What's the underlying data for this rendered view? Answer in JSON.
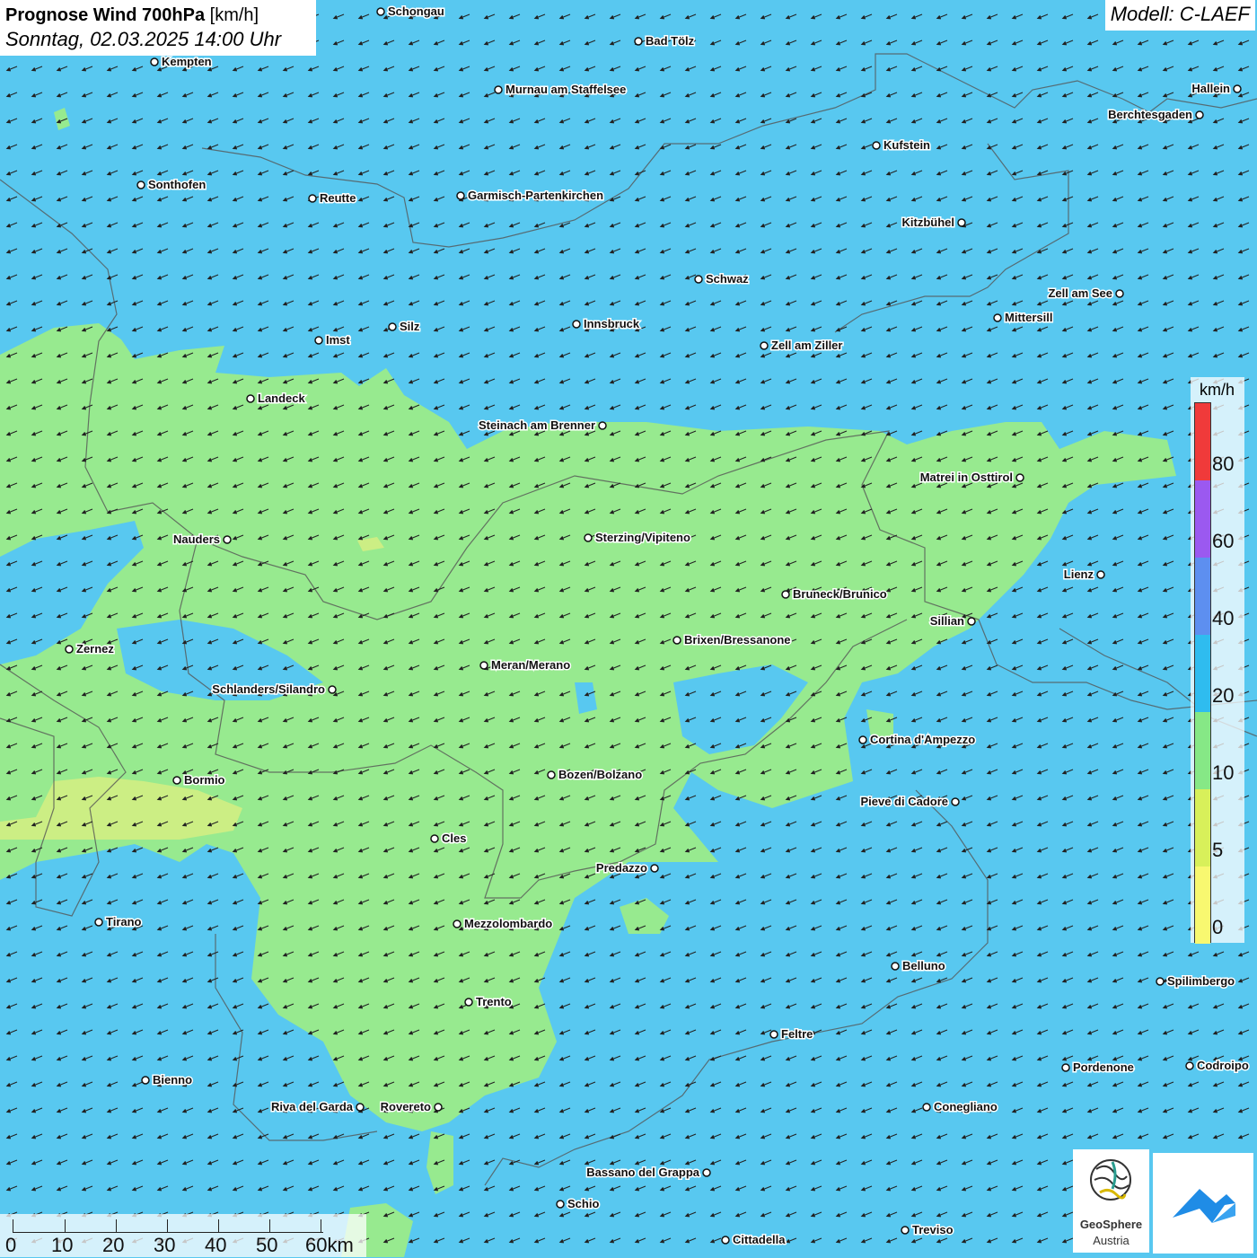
{
  "header": {
    "title_bold": "Prognose Wind 700hPa",
    "title_unit": "[km/h]",
    "datetime": "Sonntag, 02.03.2025 14:00 Uhr",
    "model": "Modell: C-LAEF"
  },
  "legend": {
    "unit": "km/h",
    "labels": [
      "80",
      "60",
      "40",
      "20",
      "10",
      "5",
      "0"
    ],
    "colors": [
      "#f03a3a",
      "#9b59f0",
      "#5d8ff0",
      "#2fbcef",
      "#86e886",
      "#d8f05a",
      "#f8f870"
    ]
  },
  "scalebar": {
    "labels": [
      "0",
      "10",
      "20",
      "30",
      "40",
      "50",
      "60km"
    ]
  },
  "logos": {
    "brand_line1": "GeoSphere",
    "brand_line2": "Austria"
  },
  "cities": [
    {
      "name": "Schongau"
    },
    {
      "name": "Bad Tölz"
    },
    {
      "name": "Kempten"
    },
    {
      "name": "Murnau am Staffelsee"
    },
    {
      "name": "Hallein"
    },
    {
      "name": "Berchtesgaden"
    },
    {
      "name": "Kufstein"
    },
    {
      "name": "Sonthofen"
    },
    {
      "name": "Reutte"
    },
    {
      "name": "Garmisch-Partenkirchen"
    },
    {
      "name": "Kitzbühel"
    },
    {
      "name": "Schwaz"
    },
    {
      "name": "Zell am See"
    },
    {
      "name": "Mittersill"
    },
    {
      "name": "Imst"
    },
    {
      "name": "Silz"
    },
    {
      "name": "Innsbruck"
    },
    {
      "name": "Zell am Ziller"
    },
    {
      "name": "Landeck"
    },
    {
      "name": "Steinach am Brenner"
    },
    {
      "name": "Matrei in Osttirol"
    },
    {
      "name": "Nauders"
    },
    {
      "name": "Sterzing/Vipiteno"
    },
    {
      "name": "Lienz"
    },
    {
      "name": "Bruneck/Brunico"
    },
    {
      "name": "Sillian"
    },
    {
      "name": "Brixen/Bressanone"
    },
    {
      "name": "Zernez"
    },
    {
      "name": "Meran/Merano"
    },
    {
      "name": "Schlanders/Silandro"
    },
    {
      "name": "Cortina d'Ampezzo"
    },
    {
      "name": "Bormio"
    },
    {
      "name": "Bozen/Bolzano"
    },
    {
      "name": "Pieve di Cadore"
    },
    {
      "name": "Cles"
    },
    {
      "name": "Predazzo"
    },
    {
      "name": "Tirano"
    },
    {
      "name": "Mezzolombardo"
    },
    {
      "name": "Belluno"
    },
    {
      "name": "Spilimbergo"
    },
    {
      "name": "Trento"
    },
    {
      "name": "Feltre"
    },
    {
      "name": "Pordenone"
    },
    {
      "name": "Codroipo"
    },
    {
      "name": "Bienno"
    },
    {
      "name": "Riva del Garda"
    },
    {
      "name": "Rovereto"
    },
    {
      "name": "Conegliano"
    },
    {
      "name": "Bassano del Grappa"
    },
    {
      "name": "Schio"
    },
    {
      "name": "Treviso"
    },
    {
      "name": "Cittadella"
    }
  ]
}
